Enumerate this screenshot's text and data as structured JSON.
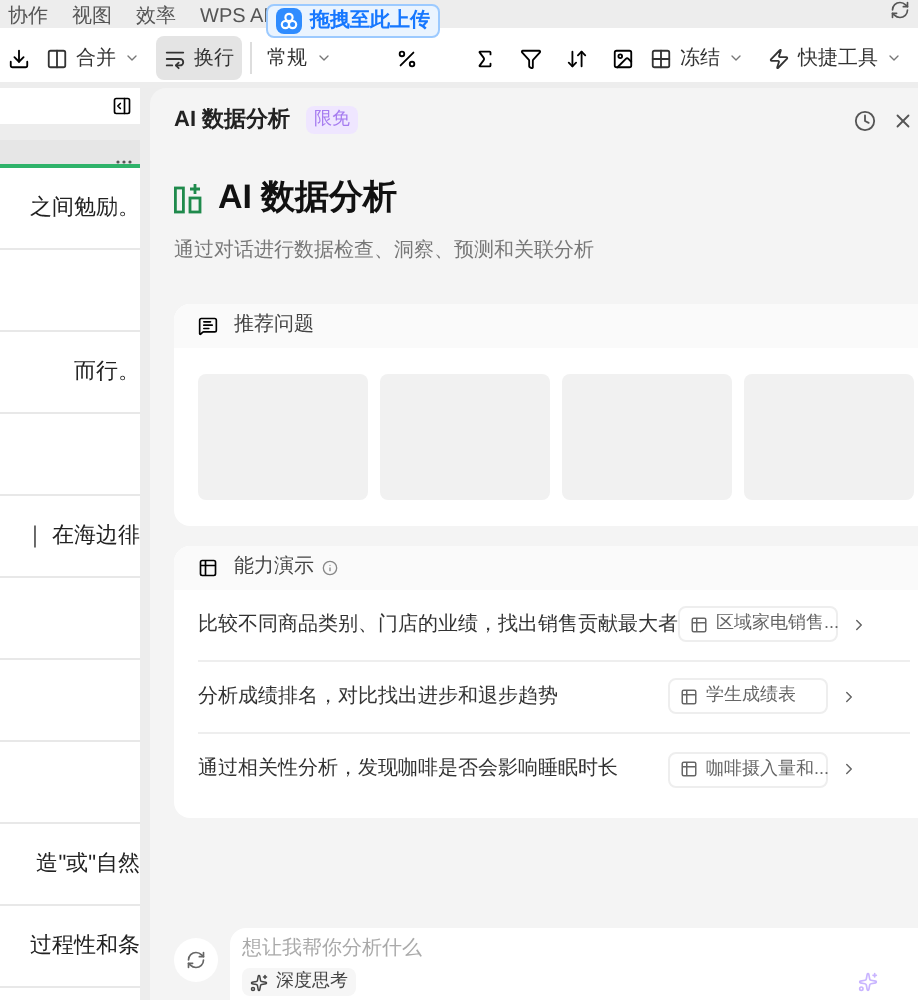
{
  "menu": [
    "协作",
    "视图",
    "效率",
    "WPS AI"
  ],
  "toolbar": [
    {
      "label": "合并",
      "kind": "merge",
      "selected": false
    },
    {
      "label": "换行",
      "kind": "wrap",
      "selected": true
    },
    {
      "label": "常规",
      "kind": "format",
      "selected": false
    },
    {
      "label": "冻结",
      "kind": "freeze",
      "selected": false
    },
    {
      "label": "快捷工具",
      "kind": "tools",
      "selected": false
    }
  ],
  "upload_tip": "拖拽至此上传",
  "sheet_rows": [
    "之间勉励。",
    "",
    "而行。",
    "",
    "｜ 在海边徘",
    "",
    "",
    "",
    "造\"或\"自然",
    "过程性和条"
  ],
  "panel": {
    "title": "AI 数据分析",
    "badge": "限免"
  },
  "hero": {
    "title": "AI 数据分析",
    "subtitle": "通过对话进行数据检查、洞察、预测和关联分析"
  },
  "recommend": {
    "title": "推荐问题"
  },
  "demo": {
    "title": "能力演示",
    "rows": [
      {
        "text": "比较不同商品类别、门店的业绩，找出销售贡献最大者",
        "file": "区域家电销售..."
      },
      {
        "text": "分析成绩排名，对比找出进步和退步趋势",
        "file": "学生成绩表"
      },
      {
        "text": "通过相关性分析，发现咖啡是否会影响睡眠时长",
        "file": "咖啡摄入量和..."
      }
    ]
  },
  "input": {
    "placeholder": "想让我帮你分析什么",
    "deep_think": "深度思考"
  }
}
